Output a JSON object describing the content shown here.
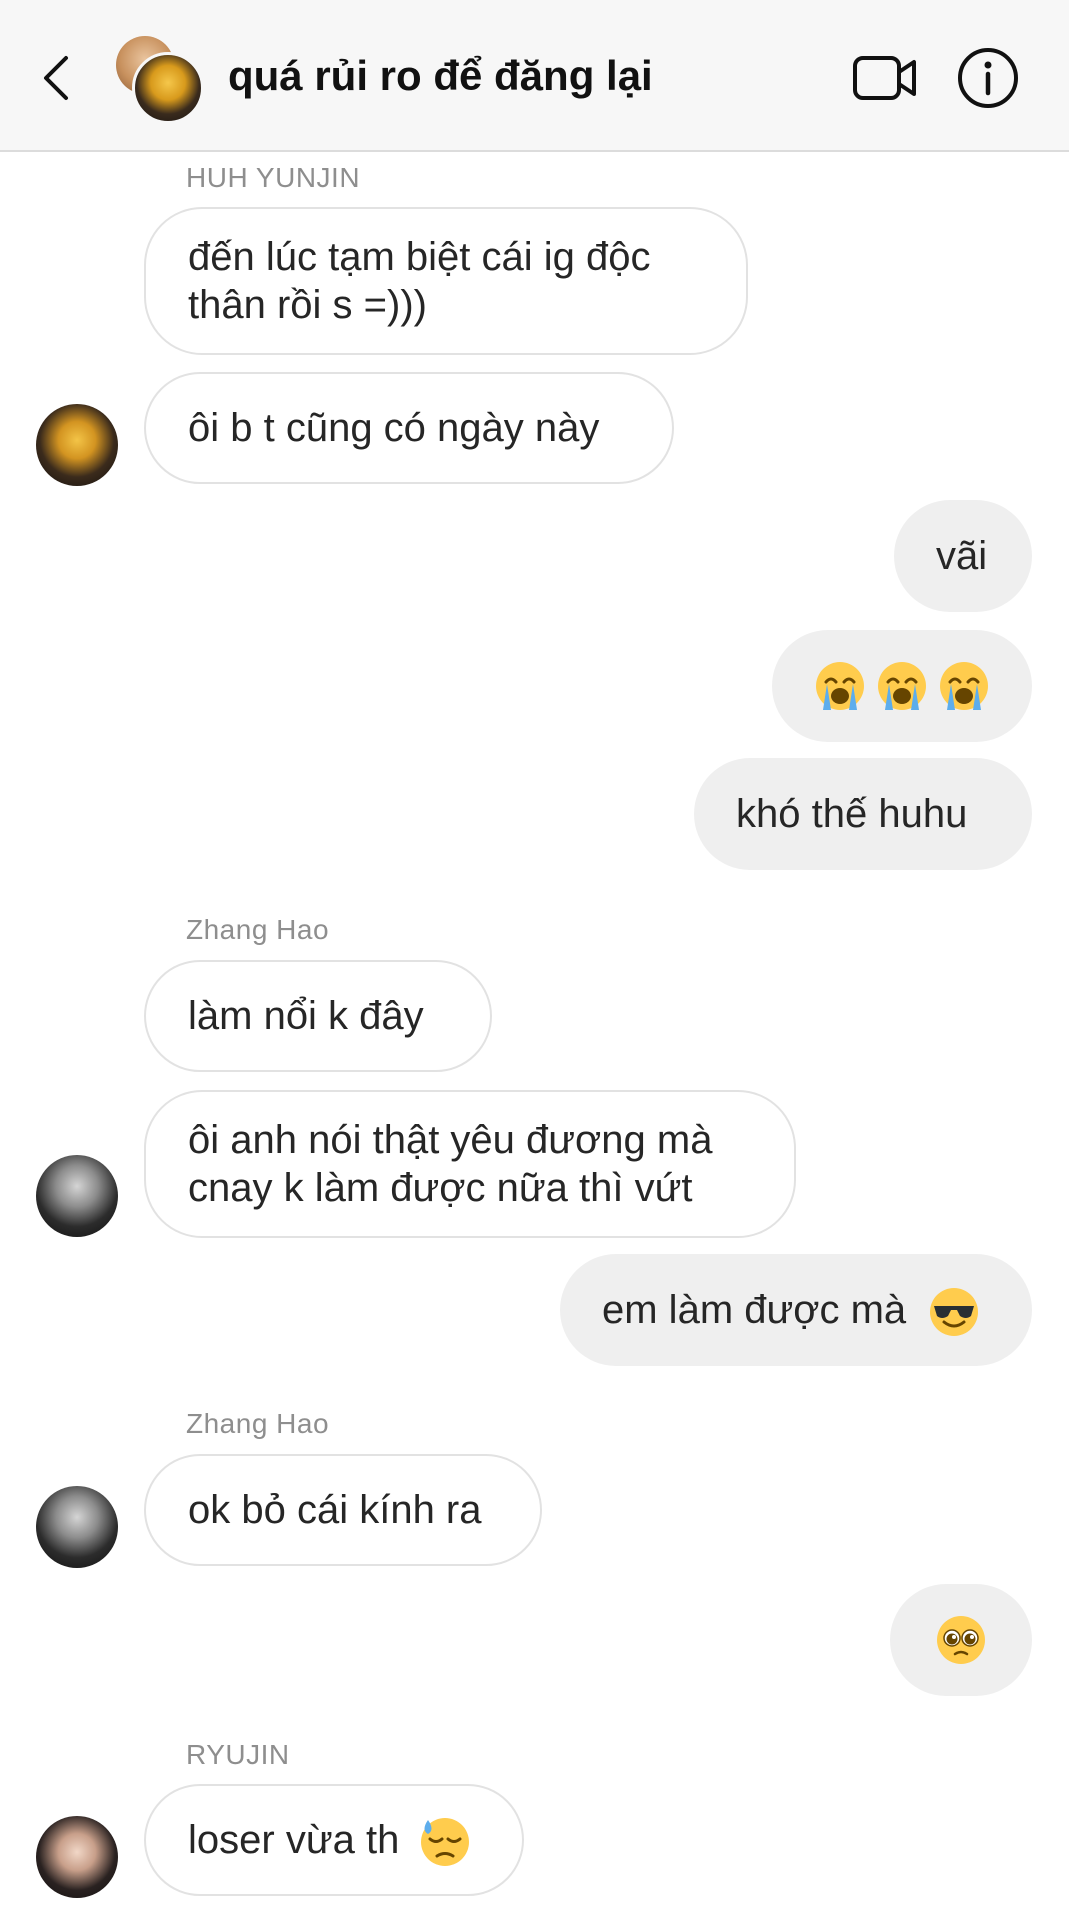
{
  "header": {
    "title": "quá rủi ro để đăng lại",
    "back_icon": "chevron-left-icon",
    "video_icon": "video-camera-icon",
    "info_icon": "info-circle-icon"
  },
  "messages": {
    "sender_yunjin": "HUH YUNJIN",
    "m1_line1": "đến lúc tạm biệt cái ig độc",
    "m1_line2": "thân rồi s =)))",
    "m2": "ôi b t cũng có ngày này",
    "m3": "vãi",
    "m4_emoji": "loudly-crying-face x3",
    "m5": "khó thế huhu",
    "sender_zhang_1": "Zhang Hao",
    "m6": "làm nổi k đây",
    "m7_line1": "ôi anh nói thật yêu đương mà",
    "m7_line2": "cnay k làm được nữa thì vứt",
    "m8": "em làm được mà",
    "m8_emoji": "smiling-face-with-sunglasses",
    "sender_zhang_2": "Zhang Hao",
    "m9": "ok bỏ cái kính ra",
    "m10_emoji": "pleading-face",
    "sender_ryujin": "RYUJIN",
    "m11": "loser vừa th",
    "m11_emoji": "downcast-face-with-sweat"
  },
  "colors": {
    "header_bg": "#f7f7f7",
    "incoming_bubble_border": "#e2e2e2",
    "outgoing_bubble_bg": "#efefef",
    "sender_label": "#8e8e8e",
    "text": "#262626"
  }
}
